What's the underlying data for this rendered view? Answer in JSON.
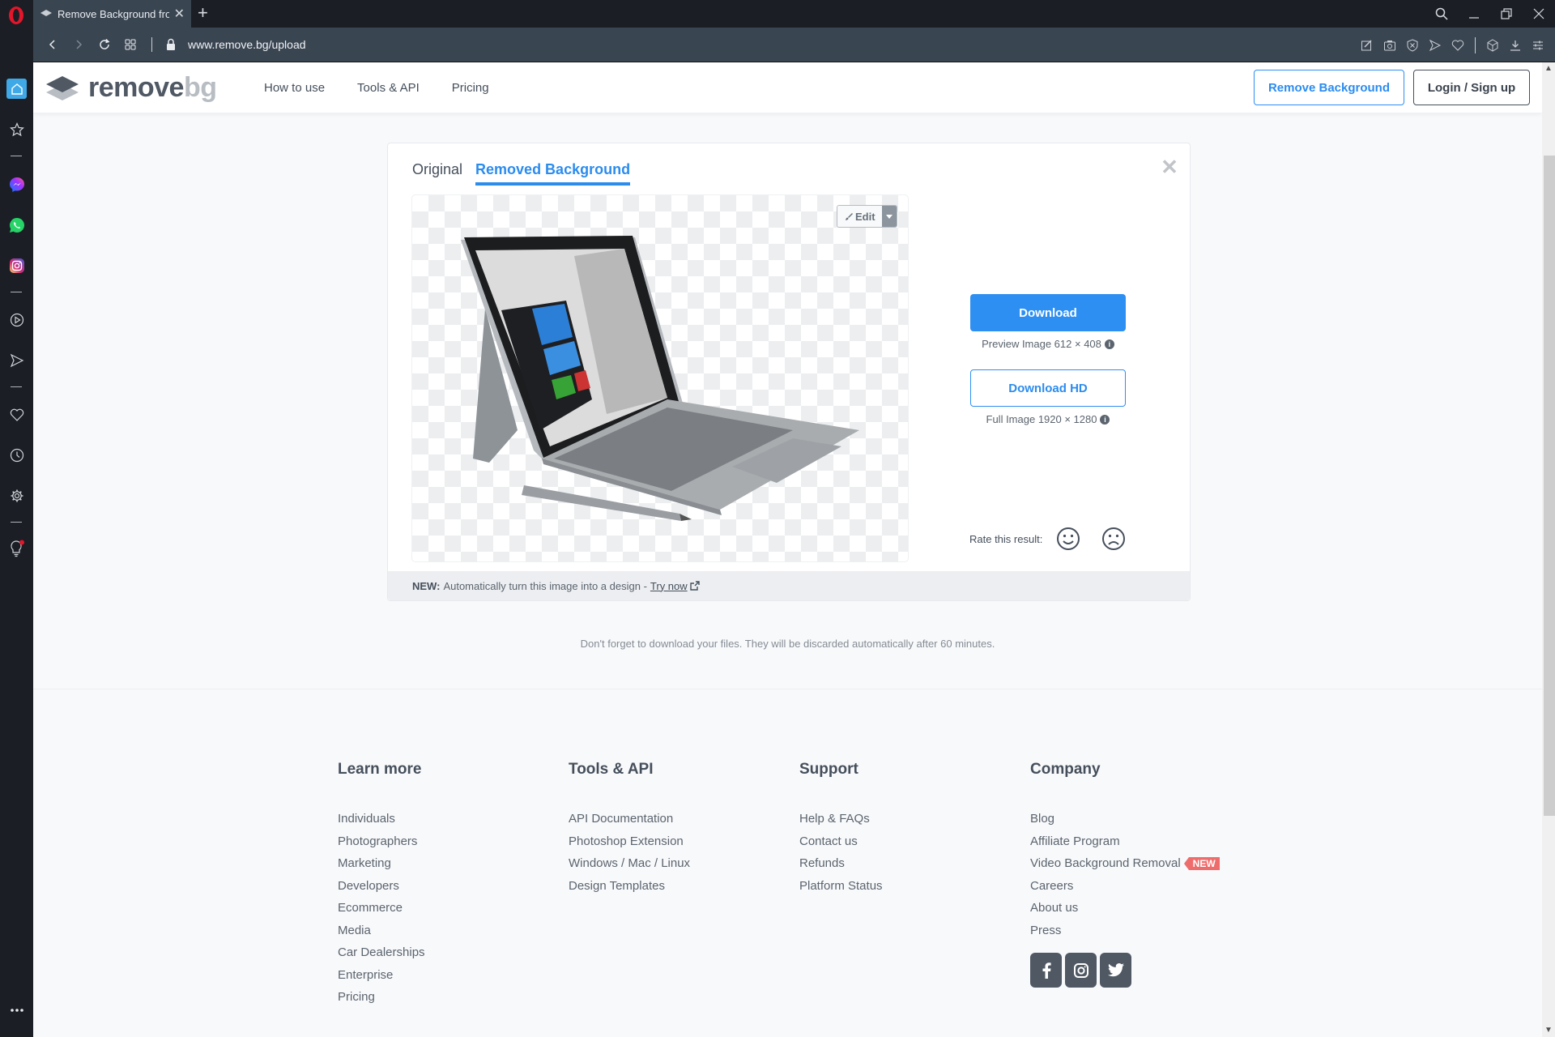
{
  "browser": {
    "tab_title": "Remove Background from I",
    "url": "www.remove.bg/upload",
    "toolbar_icons": [
      "snapshot-edit-icon",
      "camera-icon",
      "adblock-shield-icon",
      "send-icon",
      "heart-icon",
      "cube-icon",
      "download-icon",
      "easy-setup-icon"
    ],
    "sidebar_icons": [
      "home-icon",
      "star-icon",
      "messenger-icon",
      "whatsapp-icon",
      "instagram-icon",
      "player-icon",
      "send-icon",
      "heart-icon",
      "history-icon",
      "settings-icon",
      "lightbulb-icon",
      "more-icon"
    ]
  },
  "header": {
    "logo_remove": "remove",
    "logo_bg": "bg",
    "nav": [
      "How to use",
      "Tools & API",
      "Pricing"
    ],
    "remove_background_label": "Remove Background",
    "login_label": "Login / Sign up"
  },
  "card": {
    "tabs": [
      {
        "label": "Original",
        "active": false
      },
      {
        "label": "Removed Background",
        "active": true
      }
    ],
    "edit_label": "Edit",
    "download_label": "Download",
    "preview_caption": "Preview Image 612 × 408",
    "download_hd_label": "Download HD",
    "full_caption": "Full Image 1920 × 1280",
    "rate_label": "Rate this result:",
    "footer_new": "NEW:",
    "footer_text": "Automatically turn this image into a design -",
    "footer_link": "Try now"
  },
  "discard_note": "Don't forget to download your files. They will be discarded automatically after 60 minutes.",
  "footer": {
    "columns": [
      {
        "title": "Learn more",
        "items": [
          "Individuals",
          "Photographers",
          "Marketing",
          "Developers",
          "Ecommerce",
          "Media",
          "Car Dealerships",
          "Enterprise",
          "Pricing"
        ]
      },
      {
        "title": "Tools & API",
        "items": [
          "API Documentation",
          "Photoshop Extension",
          "Windows / Mac / Linux",
          "Design Templates"
        ]
      },
      {
        "title": "Support",
        "items": [
          "Help & FAQs",
          "Contact us",
          "Refunds",
          "Platform Status"
        ]
      },
      {
        "title": "Company",
        "items": [
          "Blog",
          "Affiliate Program",
          "Video Background Removal",
          "Careers",
          "About us",
          "Press"
        ]
      }
    ],
    "new_badge": "NEW",
    "social": [
      "facebook-icon",
      "instagram-icon",
      "twitter-icon"
    ]
  },
  "colors": {
    "accent": "#2d8ff2",
    "text": "#454f5b",
    "badge": "#ef6c6c",
    "chrome_dark": "#1b1e24",
    "chrome_bar": "#3a4552"
  }
}
